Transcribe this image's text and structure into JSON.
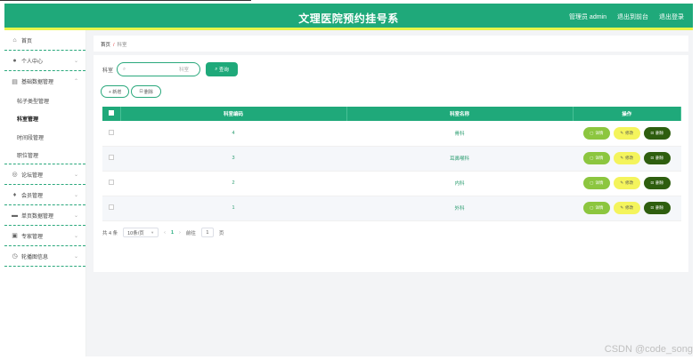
{
  "header": {
    "title": "文理医院预约挂号系",
    "nav": [
      "管理员 admin",
      "退出到前台",
      "退出登录"
    ]
  },
  "sidebar": {
    "items": [
      {
        "label": "首页",
        "icon": "home-icon",
        "type": "group",
        "chevron": false
      },
      {
        "label": "个人中心",
        "icon": "user-icon",
        "type": "group",
        "chevron": true
      },
      {
        "label": "基础数据管理",
        "icon": "database-icon",
        "type": "group-open",
        "chevron": true
      },
      {
        "label": "帖子类型管理",
        "type": "sub"
      },
      {
        "label": "科室管理",
        "type": "sub-active"
      },
      {
        "label": "时间段管理",
        "type": "sub"
      },
      {
        "label": "职位管理",
        "type": "sub-last"
      },
      {
        "label": "论坛管理",
        "icon": "forum-icon",
        "type": "group",
        "chevron": true
      },
      {
        "label": "会员管理",
        "icon": "member-icon",
        "type": "group",
        "chevron": true
      },
      {
        "label": "单页数据管理",
        "icon": "page-icon",
        "type": "group",
        "chevron": true
      },
      {
        "label": "专家管理",
        "icon": "expert-icon",
        "type": "group",
        "chevron": true
      },
      {
        "label": "轮播图信息",
        "icon": "clock-icon",
        "type": "group",
        "chevron": true
      }
    ]
  },
  "breadcrumb": {
    "home": "首页",
    "sep": "/",
    "current": "科室"
  },
  "search": {
    "label": "科室",
    "placeholder": "科室",
    "button": "查询"
  },
  "actions": {
    "add": "+ 新增",
    "delete": "删除"
  },
  "table": {
    "columns": [
      "科室编码",
      "科室名称",
      "操作"
    ],
    "rows": [
      {
        "code": "4",
        "name": "骨科"
      },
      {
        "code": "3",
        "name": "耳鼻喉科"
      },
      {
        "code": "2",
        "name": "内科"
      },
      {
        "code": "1",
        "name": "外科"
      }
    ],
    "ops": {
      "detail": "详情",
      "edit": "修改",
      "del": "删除"
    }
  },
  "pager": {
    "total": "共 4 条",
    "page_size": "10条/页",
    "prev": "‹",
    "current": "1",
    "next": "›",
    "goto_label": "前往",
    "goto_value": "1",
    "goto_suffix": "页"
  },
  "watermark": "CSDN @code_song",
  "colors": {
    "primary": "#1fa97a",
    "accent": "#e8f54a",
    "detail": "#8cc63f",
    "edit": "#f4f45c",
    "del": "#2e5e0f"
  }
}
